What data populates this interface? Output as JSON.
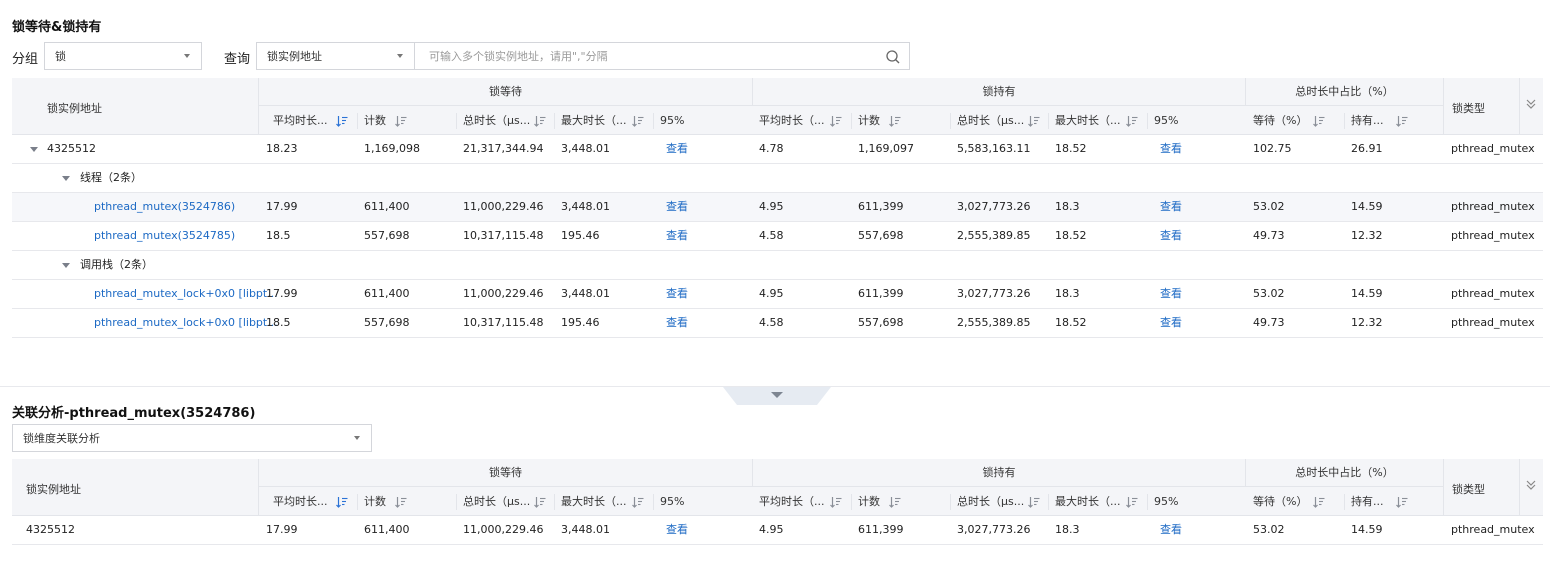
{
  "top": {
    "title": "锁等待&锁持有",
    "group_label": "分组",
    "group_value": "锁",
    "query_label": "查询",
    "query_field": "锁实例地址",
    "search_placeholder": "可输入多个锁实例地址，请用\",\"分隔"
  },
  "header": {
    "addr": "锁实例地址",
    "wait_group": "锁等待",
    "hold_group": "锁持有",
    "ratio_group": "总时长中占比（%）",
    "lock_type": "锁类型",
    "wait_cols": [
      "平均时长...",
      "计数",
      "总时长（μs...",
      "最大时长（...",
      "95%"
    ],
    "hold_cols": [
      "平均时长（...",
      "计数",
      "总时长（μs...",
      "最大时长（...",
      "95%"
    ],
    "ratio_cols": [
      "等待（%）",
      "持有..."
    ]
  },
  "rows": [
    {
      "label": "4325512",
      "vals": [
        "18.23",
        "1,169,098",
        "21,317,344.94",
        "3,448.01",
        "查看",
        "4.78",
        "1,169,097",
        "5,583,163.11",
        "18.52",
        "查看",
        "102.75",
        "26.91",
        "pthread_mutex"
      ]
    },
    {
      "label": "线程（2条）"
    },
    {
      "label": "pthread_mutex(3524786)",
      "vals": [
        "17.99",
        "611,400",
        "11,000,229.46",
        "3,448.01",
        "查看",
        "4.95",
        "611,399",
        "3,027,773.26",
        "18.3",
        "查看",
        "53.02",
        "14.59",
        "pthread_mutex"
      ]
    },
    {
      "label": "pthread_mutex(3524785)",
      "vals": [
        "18.5",
        "557,698",
        "10,317,115.48",
        "195.46",
        "查看",
        "4.58",
        "557,698",
        "2,555,389.85",
        "18.52",
        "查看",
        "49.73",
        "12.32",
        "pthread_mutex"
      ]
    },
    {
      "label": "调用栈（2条）"
    },
    {
      "label": "pthread_mutex_lock+0x0 [libpt...",
      "vals": [
        "17.99",
        "611,400",
        "11,000,229.46",
        "3,448.01",
        "查看",
        "4.95",
        "611,399",
        "3,027,773.26",
        "18.3",
        "查看",
        "53.02",
        "14.59",
        "pthread_mutex"
      ]
    },
    {
      "label": "pthread_mutex_lock+0x0 [libpt...",
      "vals": [
        "18.5",
        "557,698",
        "10,317,115.48",
        "195.46",
        "查看",
        "4.58",
        "557,698",
        "2,555,389.85",
        "18.52",
        "查看",
        "49.73",
        "12.32",
        "pthread_mutex"
      ]
    }
  ],
  "bottom": {
    "title": "关联分析-pthread_mutex(3524786)",
    "dimension": "锁维度关联分析",
    "row": {
      "label": "4325512",
      "vals": [
        "17.99",
        "611,400",
        "11,000,229.46",
        "3,448.01",
        "查看",
        "4.95",
        "611,399",
        "3,027,773.26",
        "18.3",
        "查看",
        "53.02",
        "14.59",
        "pthread_mutex"
      ]
    }
  }
}
